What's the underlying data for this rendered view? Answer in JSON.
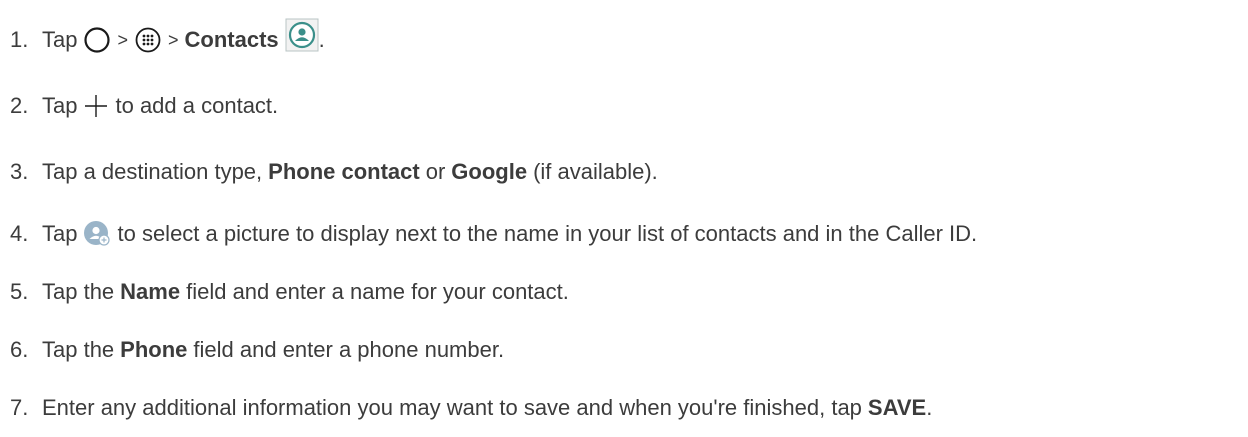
{
  "steps": [
    {
      "number": "1.",
      "parts": {
        "a": "Tap",
        "b": ">",
        "c": ">",
        "d": "Contacts",
        "e": "."
      },
      "icons": [
        "home-icon",
        "apps-icon",
        "contacts-app-icon"
      ]
    },
    {
      "number": "2.",
      "parts": {
        "a": "Tap",
        "b": "to add a contact."
      },
      "icons": [
        "add-icon"
      ]
    },
    {
      "number": "3.",
      "parts": {
        "a": "Tap a destination type,",
        "b": "Phone contact",
        "c": "or",
        "d": "Google",
        "e": "(if available)."
      }
    },
    {
      "number": "4.",
      "parts": {
        "a": "Tap",
        "b": "to select a picture to display next to the name in your list of contacts and in the Caller ID."
      },
      "icons": [
        "contact-photo-icon"
      ]
    },
    {
      "number": "5.",
      "parts": {
        "a": "Tap the",
        "b": "Name",
        "c": "field and enter a name for your contact."
      }
    },
    {
      "number": "6.",
      "parts": {
        "a": "Tap the",
        "b": "Phone",
        "c": "field and enter a phone number."
      }
    },
    {
      "number": "7.",
      "parts": {
        "a": "Enter any additional information you may want to save and when you're finished, tap",
        "b": "SAVE",
        "c": "."
      }
    }
  ],
  "colors": {
    "text": "#3c3c3c",
    "icon_stroke": "#1a1a1a",
    "contacts_icon_fill": "#3a8f8a",
    "contact_photo_fill": "#9ab4c8"
  }
}
